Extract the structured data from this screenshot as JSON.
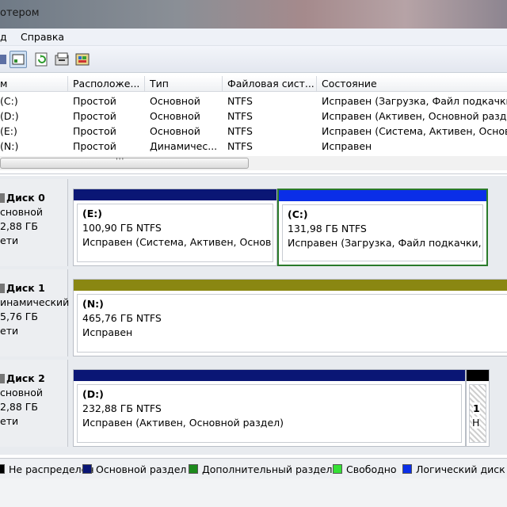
{
  "window": {
    "title": "отером"
  },
  "menu": [
    "д",
    "Справка"
  ],
  "volumes": {
    "headers": [
      "м",
      "Расположе...",
      "Тип",
      "Файловая сист...",
      "Состояние"
    ],
    "rows": [
      [
        "(C:)",
        "Простой",
        "Основной",
        "NTFS",
        "Исправен (Загрузка, Файл подкачки, "
      ],
      [
        "(D:)",
        "Простой",
        "Основной",
        "NTFS",
        "Исправен (Активен, Основной разде"
      ],
      [
        "(E:)",
        "Простой",
        "Основной",
        "NTFS",
        "Исправен (Система, Активен, Основ"
      ],
      [
        "(N:)",
        "Простой",
        "Динамичес...",
        "NTFS",
        "Исправен"
      ]
    ],
    "scroll_label": "'''"
  },
  "disks": [
    {
      "name": "Диск 0",
      "type": "сновной",
      "size": "2,88 ГБ",
      "status": "ети",
      "partitions": [
        {
          "label": "(E:)",
          "size": "100,90 ГБ NTFS",
          "status": "Исправен (Система, Активен, Основной",
          "bar_color": "#0a1675"
        },
        {
          "label": "(C:)",
          "size": "131,98 ГБ NTFS",
          "status": "Исправен (Загрузка, Файл подкачки, А",
          "bar_color": "#0a2ee8"
        }
      ]
    },
    {
      "name": "Диск 1",
      "type": "инамический",
      "size": "5,76 ГБ",
      "status": "ети",
      "partitions": [
        {
          "label": "(N:)",
          "size": "465,76 ГБ NTFS",
          "status": "Исправен",
          "bar_color": "#8a8712"
        }
      ]
    },
    {
      "name": "Диск 2",
      "type": "сновной",
      "size": "2,88 ГБ",
      "status": "ети",
      "partitions": [
        {
          "label": "(D:)",
          "size": "232,88 ГБ NTFS",
          "status": "Исправен (Активен, Основной раздел)",
          "bar_color": "#0a1675"
        },
        {
          "label": "1",
          "size": "Н",
          "status": "",
          "bar_color": "#000000"
        }
      ]
    }
  ],
  "legend": [
    {
      "label": "Не распределен",
      "color": "#000000"
    },
    {
      "label": "Основной раздел",
      "color": "#0a1675"
    },
    {
      "label": "Дополнительный раздел",
      "color": "#1c8a1c"
    },
    {
      "label": "Свободно",
      "color": "#35e035"
    },
    {
      "label": "Логический диск",
      "color": "#0a2ee8"
    }
  ]
}
